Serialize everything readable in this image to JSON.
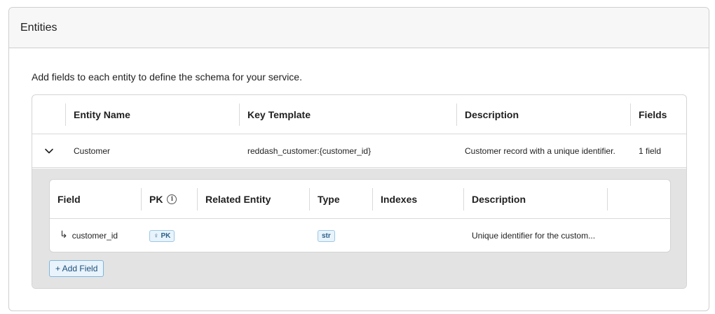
{
  "panel": {
    "title": "Entities"
  },
  "intro": "Add fields to each entity to define the schema for your service.",
  "entity_table": {
    "columns": [
      "Entity Name",
      "Key Template",
      "Description",
      "Fields"
    ],
    "rows": [
      {
        "name": "Customer",
        "key_template": "reddash_customer:{customer_id}",
        "description": "Customer record with a unique identifier.",
        "fields": "1 field",
        "expanded": true
      }
    ]
  },
  "field_table": {
    "columns": [
      "Field",
      "PK",
      "Related Entity",
      "Type",
      "Indexes",
      "Description"
    ],
    "rows": [
      {
        "field": "customer_id",
        "pk_badge": "PK",
        "related_entity": "",
        "type": "str",
        "indexes": "",
        "description": "Unique identifier for the custom..."
      }
    ]
  },
  "add_field_label": "+ Add Field",
  "icons": {
    "expand": "chevron-down-icon",
    "pk_info": "info-icon",
    "field_child": "child-arrow-icon",
    "pk_key": "key-icon"
  },
  "colors": {
    "badge_bg": "#e8f3fb",
    "badge_border": "#9cc7e6",
    "badge_text": "#2b5f86",
    "nested_bg": "#e3e3e3"
  }
}
